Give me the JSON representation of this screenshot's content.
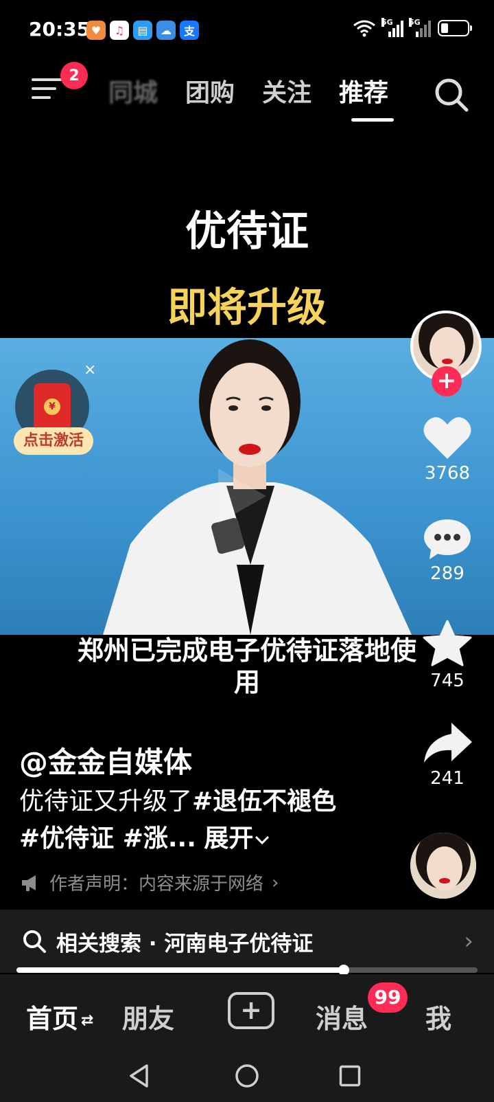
{
  "status_bar": {
    "time": "20:35",
    "app_icons": [
      {
        "name": "heart-app-icon",
        "color": "#f08a3c",
        "glyph": "♥"
      },
      {
        "name": "music-app-icon",
        "color": "#ffffff",
        "glyph": "♫"
      },
      {
        "name": "book-app-icon",
        "color": "#2d9cf0",
        "glyph": "▤"
      },
      {
        "name": "weather-app-icon",
        "color": "#3a8ee6",
        "glyph": "☁"
      },
      {
        "name": "alipay-app-icon",
        "color": "#1677ff",
        "glyph": "支"
      }
    ],
    "network_1": "5G",
    "network_2": "5G"
  },
  "top_nav": {
    "menu_badge": "2",
    "tabs": [
      {
        "label": "同城",
        "state": "blurred"
      },
      {
        "label": "团购",
        "state": "normal"
      },
      {
        "label": "关注",
        "state": "normal"
      },
      {
        "label": "推荐",
        "state": "active"
      }
    ]
  },
  "video": {
    "headline_1": "优待证",
    "headline_2": "即将升级",
    "caption": "郑州已完成电子优待证落地使用"
  },
  "red_packet": {
    "label": "点击激活",
    "close": "×"
  },
  "right_rail": {
    "likes": "3768",
    "comments": "289",
    "favorites": "745",
    "shares": "241",
    "follow_symbol": "+"
  },
  "post": {
    "author": "@金金自媒体",
    "description_plain": "优待证又升级了",
    "description_tags": "#退伍不褪色 #优待证 #涨...",
    "expand_label": "展开",
    "disclaimer": "作者声明：内容来源于网络"
  },
  "related_search": {
    "text": "相关搜索 · 河南电子优待证",
    "arrow": "›"
  },
  "playback": {
    "progress_fraction": 0.71
  },
  "bottom_nav": {
    "home": "首页",
    "friends": "朋友",
    "create": "+",
    "messages": "消息",
    "messages_badge": "99",
    "me": "我"
  },
  "colors": {
    "accent": "#fe2c55",
    "headline_gold": "#f6d35a",
    "video_bg": "#3b93cf"
  }
}
